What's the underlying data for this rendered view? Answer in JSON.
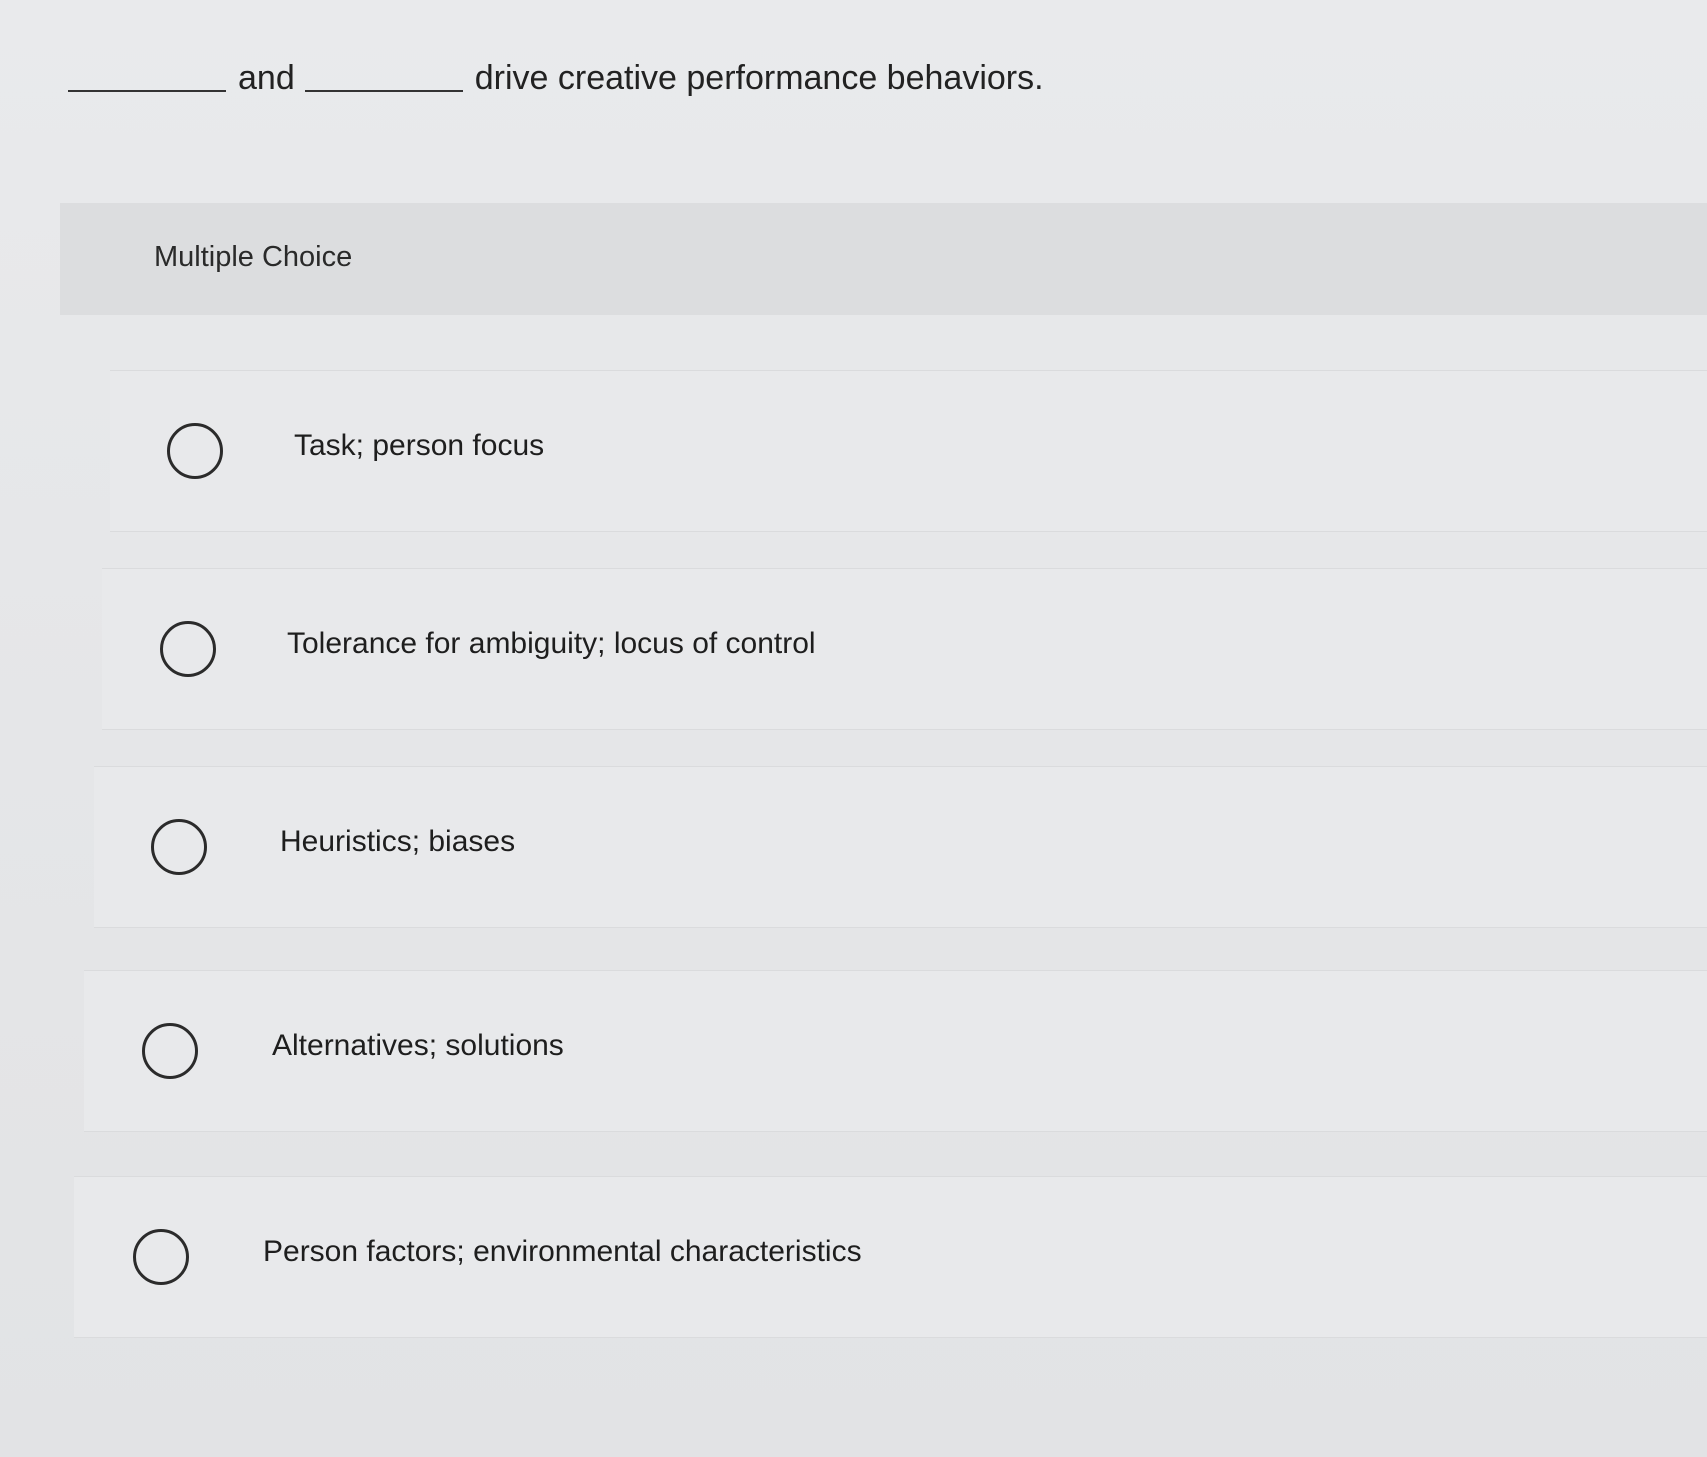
{
  "question": {
    "word_and": "and",
    "stem_tail": "drive creative performance behaviors."
  },
  "header": {
    "title": "Multiple Choice"
  },
  "options": [
    {
      "label": "Task; person focus"
    },
    {
      "label": "Tolerance for ambiguity; locus of control"
    },
    {
      "label": "Heuristics; biases"
    },
    {
      "label": "Alternatives; solutions"
    },
    {
      "label": "Person factors; environmental characteristics"
    }
  ]
}
